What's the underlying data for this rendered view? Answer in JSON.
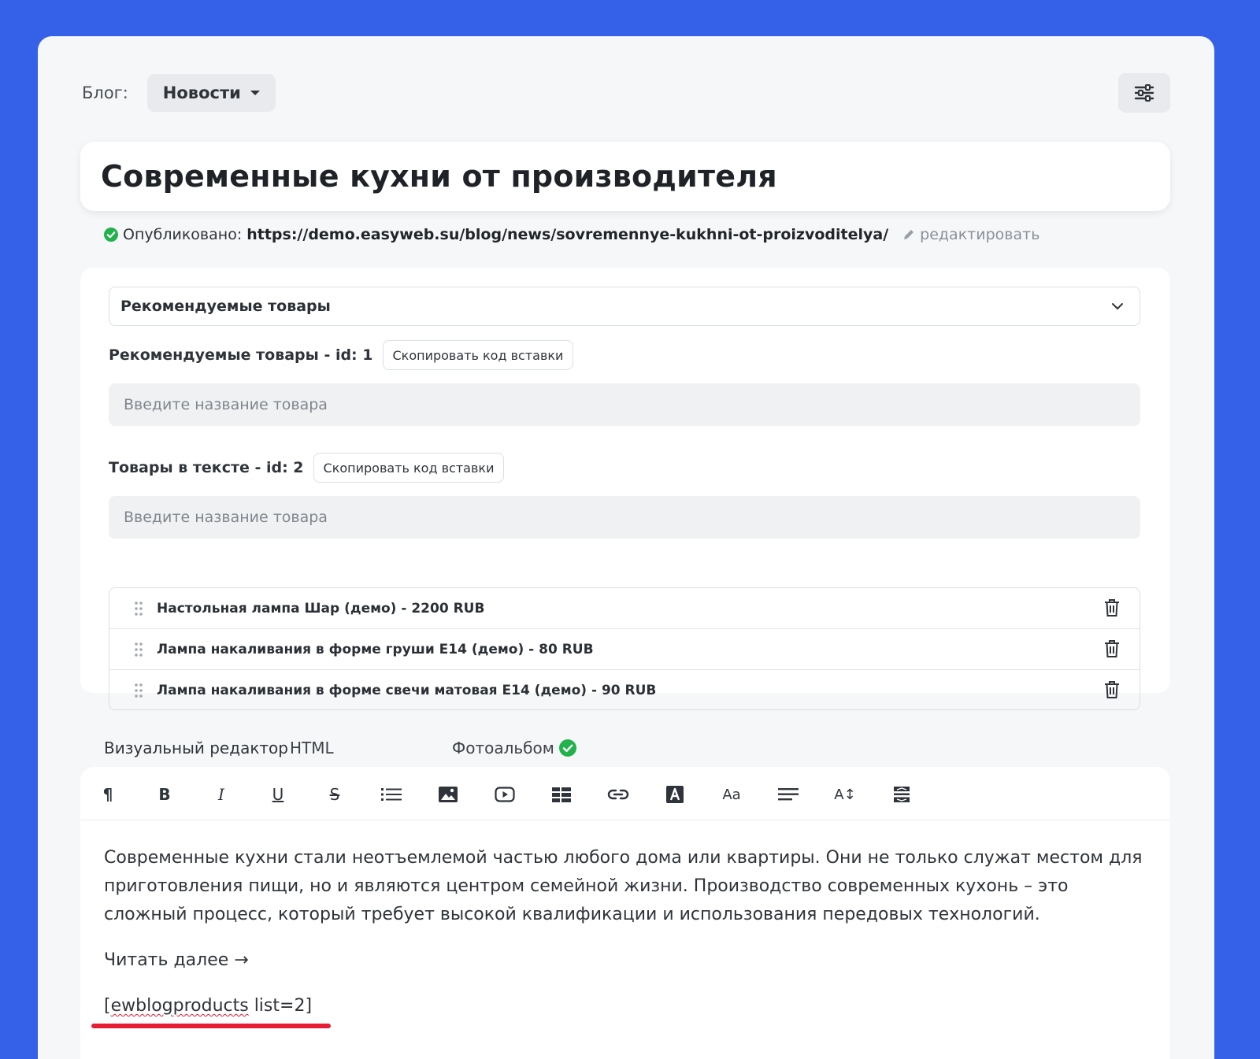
{
  "blog": {
    "label": "Блог:",
    "selected": "Новости"
  },
  "post": {
    "title": "Современные кухни от производителя",
    "published_label": "Опубликовано:",
    "url": "https://demo.easyweb.su/blog/news/sovremennye-kukhni-ot-proizvoditelya/",
    "edit_label": "редактировать"
  },
  "products": {
    "select_value": "Рекомендуемые товары",
    "groups": [
      {
        "label": "Рекомендуемые товары - id: 1",
        "copy_label": "Скопировать код вставки",
        "placeholder": "Введите название товара"
      },
      {
        "label": "Товары в тексте - id: 2",
        "copy_label": "Скопировать код вставки",
        "placeholder": "Введите название товара"
      }
    ],
    "items": [
      "Настольная лампа Шар (демо) - 2200 RUB",
      "Лампа накаливания в форме груши E14 (демо) - 80 RUB",
      "Лампа накаливания в форме свечи матовая E14 (демо) - 90 RUB"
    ]
  },
  "tabs": [
    {
      "label": "Визуальный редактор",
      "active": true
    },
    {
      "label": "HTML",
      "active": false
    },
    {
      "label": "Фотоальбом",
      "active": false
    }
  ],
  "toolbar": {
    "icons": [
      "paragraph-icon",
      "bold-icon",
      "italic-icon",
      "underline-icon",
      "strikethrough-icon",
      "list-icon",
      "image-icon",
      "video-icon",
      "table-icon",
      "link-icon",
      "text-color-icon",
      "font-size-icon",
      "align-icon",
      "line-height-icon",
      "hr-icon"
    ],
    "paragraph": "¶",
    "bold": "B",
    "italic": "I",
    "underline": "U",
    "strike": "S",
    "font": "Aa",
    "line_height": "A↕"
  },
  "content": {
    "paragraph": "Современные кухни стали неотъемлемой частью любого дома или квартиры. Они не только служат местом для приготовления пищи, но и являются центром семейной жизни. Производство современных кухонь – это сложный процесс, который требует высокой квалификации и использования передовых технологий.",
    "read_more": "Читать далее →",
    "shortcode_open": "[",
    "shortcode_word": "ewblogproducts",
    "shortcode_rest": " list=2]"
  },
  "colors": {
    "background": "#3561e8",
    "accent": "#2d7be0",
    "success": "#22b24c",
    "highlight": "#e51c34"
  }
}
